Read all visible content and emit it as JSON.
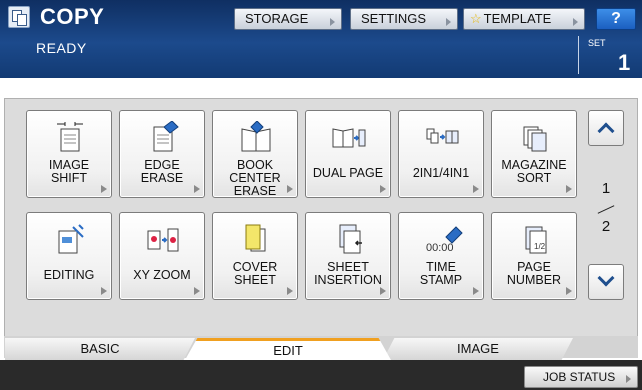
{
  "header": {
    "title": "COPY",
    "status": "READY",
    "set_label": "SET",
    "set_count": "1",
    "storage_label": "STORAGE",
    "settings_label": "SETTINGS",
    "template_label": "TEMPLATE",
    "help_label": "?"
  },
  "functions": [
    {
      "label": "IMAGE\nSHIFT",
      "icon": "image-shift-icon"
    },
    {
      "label": "EDGE\nERASE",
      "icon": "edge-erase-icon"
    },
    {
      "label": "BOOK CENTER\nERASE",
      "icon": "book-center-erase-icon"
    },
    {
      "label": "DUAL PAGE",
      "icon": "dual-page-icon"
    },
    {
      "label": "2IN1/4IN1",
      "icon": "2in1-4in1-icon"
    },
    {
      "label": "MAGAZINE\nSORT",
      "icon": "magazine-sort-icon"
    },
    {
      "label": "EDITING",
      "icon": "editing-icon"
    },
    {
      "label": "XY ZOOM",
      "icon": "xy-zoom-icon"
    },
    {
      "label": "COVER\nSHEET",
      "icon": "cover-sheet-icon"
    },
    {
      "label": "SHEET\nINSERTION",
      "icon": "sheet-insertion-icon"
    },
    {
      "label": "TIME\nSTAMP",
      "icon": "time-stamp-icon",
      "icon_text": "00:00"
    },
    {
      "label": "PAGE\nNUMBER",
      "icon": "page-number-icon"
    }
  ],
  "pagination": {
    "current": "1",
    "total": "2"
  },
  "tabs": [
    {
      "label": "BASIC",
      "active": false
    },
    {
      "label": "EDIT",
      "active": true
    },
    {
      "label": "IMAGE",
      "active": false
    }
  ],
  "footer": {
    "job_status_label": "JOB STATUS"
  },
  "colors": {
    "header": "#1c4a8c",
    "active_tab": "#f0a020",
    "help": "#1b5fc0"
  }
}
